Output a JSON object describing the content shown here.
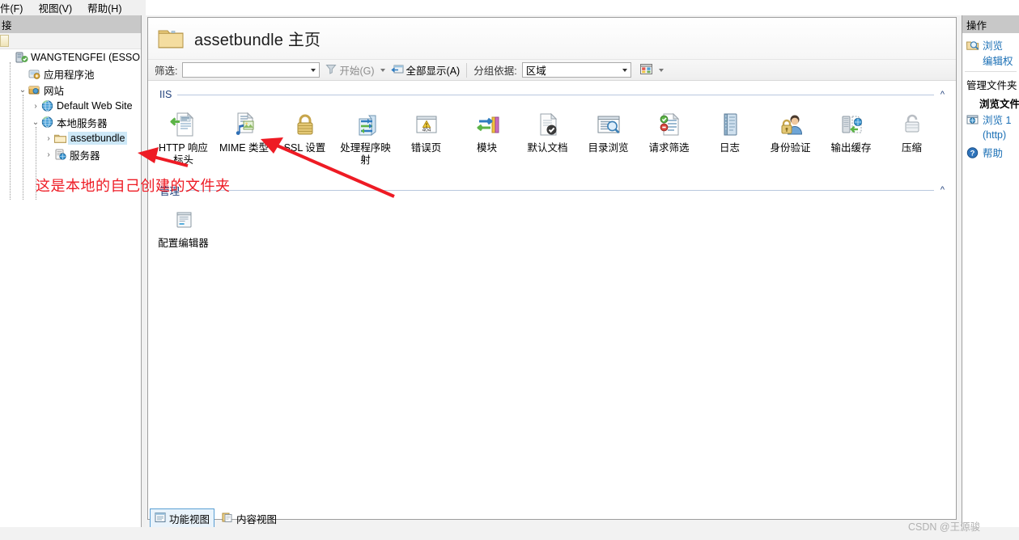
{
  "menubar": {
    "items": [
      {
        "label": "件(F)",
        "accel": "F"
      },
      {
        "label": "视图(V)",
        "accel": "V"
      },
      {
        "label": "帮助(H)",
        "accel": "H"
      }
    ]
  },
  "connections": {
    "header": "接",
    "tree": [
      {
        "label": "WANGTENGFEI (ESSOFT\\w",
        "icon": "server-icon",
        "indent": 0,
        "twist": "",
        "selected": false
      },
      {
        "label": "应用程序池",
        "icon": "app-pool-icon",
        "indent": 1,
        "twist": "",
        "selected": false
      },
      {
        "label": "网站",
        "icon": "sites-icon",
        "indent": 1,
        "twist": "v",
        "selected": false
      },
      {
        "label": "Default Web Site",
        "icon": "globe-icon",
        "indent": 2,
        "twist": ">",
        "selected": false
      },
      {
        "label": "本地服务器",
        "icon": "globe-icon",
        "indent": 2,
        "twist": "v",
        "selected": false
      },
      {
        "label": "assetbundle",
        "icon": "folder-icon",
        "indent": 3,
        "twist": ">",
        "selected": true
      },
      {
        "label": "服务器",
        "icon": "vdir-icon",
        "indent": 3,
        "twist": ">",
        "selected": false
      }
    ]
  },
  "page": {
    "folder_icon": "folder-icon",
    "title": "assetbundle 主页"
  },
  "filter_bar": {
    "filter_label": "筛选:",
    "filter_value": "",
    "start_label": "开始(G)",
    "show_all_label": "全部显示(A)",
    "group_by_label": "分组依据:",
    "group_by_value": "区域"
  },
  "sections": [
    {
      "name": "IIS",
      "chevron": "^",
      "tiles": [
        {
          "label": "HTTP 响应标头",
          "icon": "http-response-headers-icon"
        },
        {
          "label": "MIME 类型",
          "icon": "mime-types-icon"
        },
        {
          "label": "SSL 设置",
          "icon": "ssl-settings-icon"
        },
        {
          "label": "处理程序映射",
          "icon": "handler-mappings-icon"
        },
        {
          "label": "错误页",
          "icon": "error-pages-icon"
        },
        {
          "label": "模块",
          "icon": "modules-icon"
        },
        {
          "label": "默认文档",
          "icon": "default-document-icon"
        },
        {
          "label": "目录浏览",
          "icon": "directory-browsing-icon"
        },
        {
          "label": "请求筛选",
          "icon": "request-filtering-icon"
        },
        {
          "label": "日志",
          "icon": "logging-icon"
        },
        {
          "label": "身份验证",
          "icon": "authentication-icon"
        },
        {
          "label": "输出缓存",
          "icon": "output-caching-icon"
        },
        {
          "label": "压缩",
          "icon": "compression-icon"
        }
      ]
    },
    {
      "name": "管理",
      "chevron": "^",
      "tiles": [
        {
          "label": "配置编辑器",
          "icon": "configuration-editor-icon"
        }
      ]
    }
  ],
  "actions": {
    "header": "操作",
    "items": [
      {
        "label": "浏览",
        "icon": "browse-icon",
        "type": "link"
      },
      {
        "label": "编辑权",
        "icon": "",
        "type": "link"
      }
    ],
    "group_title": "管理文件夹",
    "sub_title": "浏览文件夹",
    "browse_link_line1": "浏览 1",
    "browse_link_line2": "(http)",
    "browse_icon": "browse-globe-icon",
    "help_label": "帮助",
    "help_icon": "help-icon"
  },
  "view_tabs": [
    {
      "label": "功能视图",
      "icon": "features-view-icon",
      "active": true
    },
    {
      "label": "内容视图",
      "icon": "content-view-icon",
      "active": false
    }
  ],
  "annotations": {
    "red_note": "这是本地的自己创建的文件夹",
    "red_color": "#ee1b24"
  },
  "watermark": "CSDN @王源骏"
}
